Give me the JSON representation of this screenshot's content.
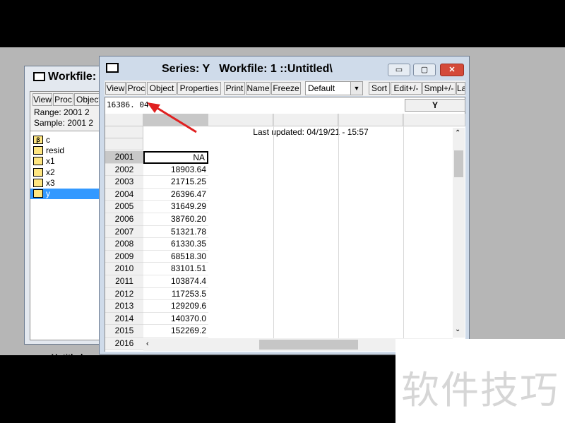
{
  "workfile_window": {
    "title": "Workfile:",
    "toolbar": [
      "View",
      "Proc",
      "Object"
    ],
    "range_label": "Range:  2001 2",
    "sample_label": "Sample: 2001 2",
    "items": [
      {
        "icon": "β",
        "label": "c"
      },
      {
        "icon": "",
        "label": "resid"
      },
      {
        "icon": "",
        "label": "x1"
      },
      {
        "icon": "",
        "label": "x2"
      },
      {
        "icon": "",
        "label": "x3"
      },
      {
        "icon": "",
        "label": "y",
        "selected": true
      }
    ],
    "nav_arrows": "< >",
    "tab_label": "Untitled"
  },
  "series_window": {
    "title": "Series: Y   Workfile: 1 ::Untitled\\",
    "controls": {
      "minimize": "▭",
      "maximize": "▢",
      "close": "✕"
    },
    "toolbar": {
      "view": "View",
      "proc": "Proc",
      "object": "Object",
      "properties": "Properties",
      "print": "Print",
      "name": "Name",
      "freeze": "Freeze",
      "display_format": "Default",
      "sort": "Sort",
      "edit": "Edit+/-",
      "smpl": "Smpl+/-",
      "label": "La"
    },
    "edit_value": "16386. 04",
    "column_header": "Y",
    "last_updated": "Last updated: 04/19/21 - 15:57",
    "rows": [
      {
        "year": "2001",
        "value": "NA"
      },
      {
        "year": "2002",
        "value": "18903.64"
      },
      {
        "year": "2003",
        "value": "21715.25"
      },
      {
        "year": "2004",
        "value": "26396.47"
      },
      {
        "year": "2005",
        "value": "31649.29"
      },
      {
        "year": "2006",
        "value": "38760.20"
      },
      {
        "year": "2007",
        "value": "51321.78"
      },
      {
        "year": "2008",
        "value": "61330.35"
      },
      {
        "year": "2009",
        "value": "68518.30"
      },
      {
        "year": "2010",
        "value": "83101.51"
      },
      {
        "year": "2011",
        "value": "103874.4"
      },
      {
        "year": "2012",
        "value": "117253.5"
      },
      {
        "year": "2013",
        "value": "129209.6"
      },
      {
        "year": "2014",
        "value": "140370.0"
      },
      {
        "year": "2015",
        "value": "152269.2"
      },
      {
        "year": "2016",
        "value": ""
      }
    ]
  },
  "watermark": "软件技巧",
  "colors": {
    "selection": "#3399ff",
    "annotation_arrow": "#e02020",
    "close_button": "#d44a3a"
  }
}
